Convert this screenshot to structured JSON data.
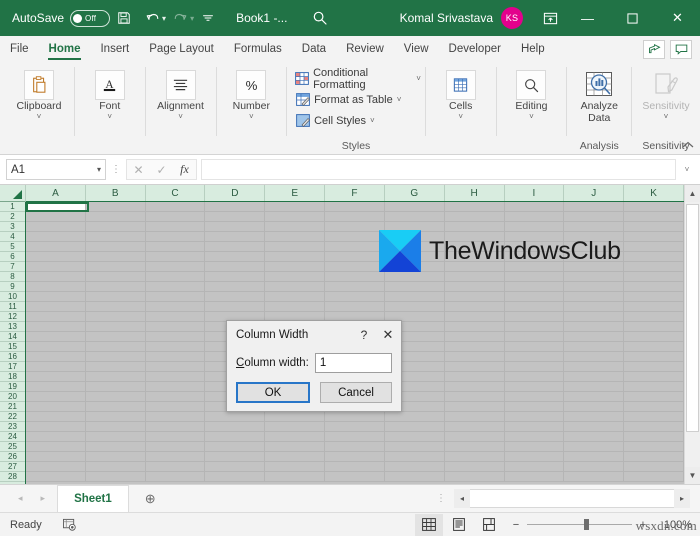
{
  "titlebar": {
    "autosave_label": "AutoSave",
    "autosave_state": "Off",
    "save_icon": "save-icon",
    "undo_icon": "undo-icon",
    "redo_icon": "redo-icon",
    "customize_icon": "customize-quick-access-icon",
    "document_title": "Book1 -...",
    "search_icon": "search-icon",
    "user_name": "Komal Srivastava",
    "avatar_initials": "KS",
    "ribbon_display_icon": "ribbon-display-options-icon",
    "minimize": "—",
    "maximize": "☐",
    "close": "✕",
    "bg_color": "#217346",
    "avatar_color": "#e3008c"
  },
  "tabs": [
    {
      "label": "File",
      "active": false
    },
    {
      "label": "Home",
      "active": true
    },
    {
      "label": "Insert",
      "active": false
    },
    {
      "label": "Page Layout",
      "active": false
    },
    {
      "label": "Formulas",
      "active": false
    },
    {
      "label": "Data",
      "active": false
    },
    {
      "label": "Review",
      "active": false
    },
    {
      "label": "View",
      "active": false
    },
    {
      "label": "Developer",
      "active": false
    },
    {
      "label": "Help",
      "active": false
    }
  ],
  "tab_actions": {
    "share_icon": "share-icon",
    "comments_icon": "comments-icon"
  },
  "ribbon": {
    "groups": [
      {
        "label": "Clipboard",
        "icon": "clipboard-icon",
        "chevron": "˅"
      },
      {
        "label": "Font",
        "icon": "font-icon",
        "chevron": "˅"
      },
      {
        "label": "Alignment",
        "icon": "alignment-icon",
        "chevron": "˅"
      },
      {
        "label": "Number",
        "icon": "percent-icon",
        "chevron": "˅"
      }
    ],
    "styles": {
      "group_label": "Styles",
      "items": [
        {
          "label": "Conditional Formatting",
          "icon": "conditional-formatting-icon",
          "chevron": "˅"
        },
        {
          "label": "Format as Table",
          "icon": "format-as-table-icon",
          "chevron": "˅"
        },
        {
          "label": "Cell Styles",
          "icon": "cell-styles-icon",
          "chevron": "˅"
        }
      ]
    },
    "cells": {
      "label": "Cells",
      "icon": "cells-icon",
      "chevron": "˅"
    },
    "editing": {
      "label": "Editing",
      "icon": "editing-magnifier-icon",
      "chevron": "˅"
    },
    "analyze": {
      "label_line1": "Analyze",
      "label_line2": "Data",
      "icon": "analyze-data-icon",
      "group_label": "Analysis"
    },
    "sensitivity": {
      "label": "Sensitivity",
      "icon": "sensitivity-icon",
      "chevron": "˅",
      "group_label": "Sensitivity",
      "disabled": true
    },
    "collapse_icon": "collapse-ribbon-chevron-icon"
  },
  "formula_bar": {
    "name_box_value": "A1",
    "name_box_caret": "▾",
    "cancel_icon": "✕",
    "enter_icon": "✓",
    "function_icon": "fx",
    "formula_value": "",
    "dropdown_icon": "˅"
  },
  "grid": {
    "columns": [
      "A",
      "B",
      "C",
      "D",
      "E",
      "F",
      "G",
      "H",
      "I",
      "J",
      "K"
    ],
    "rows": [
      1,
      2,
      3,
      4,
      5,
      6,
      7,
      8,
      9,
      10,
      11,
      12,
      13,
      14,
      15,
      16,
      17,
      18,
      19,
      20,
      21,
      22,
      23,
      24,
      25,
      26,
      27,
      28
    ],
    "active_cell": "A1",
    "select_all_corner": "select-all-triangle",
    "selection_color": "#217346",
    "selected_fill": "#c3c3c3",
    "header_fill": "#d8ecdf"
  },
  "watermark_logo": {
    "text": "TheWindowsClub",
    "colors": [
      "#18c8f0",
      "#0a9ae8",
      "#1258d8",
      "#0f3fd0"
    ]
  },
  "dialog": {
    "title": "Column Width",
    "help_icon": "?",
    "close_icon": "✕",
    "field_label_prefix": "C",
    "field_label_rest": "olumn width:",
    "field_value": "1",
    "ok_label": "OK",
    "cancel_label": "Cancel"
  },
  "sheetbar": {
    "prev_icon": "◂",
    "next_icon": "▸",
    "tabs": [
      {
        "label": "Sheet1",
        "active": true
      }
    ],
    "add_sheet_icon": "⊕",
    "hscroll_left": "◂",
    "hscroll_right": "▸"
  },
  "statusbar": {
    "status": "Ready",
    "recording_icon": "macro-record-icon",
    "views": [
      {
        "name": "normal-view",
        "icon": "⊞",
        "active": true
      },
      {
        "name": "page-layout-view",
        "icon": "▤",
        "active": false
      },
      {
        "name": "page-break-preview",
        "icon": "⌧",
        "active": false
      }
    ],
    "zoom_out": "−",
    "zoom_in": "+",
    "zoom_level": "100%",
    "watermark": "wsxdn.com"
  }
}
